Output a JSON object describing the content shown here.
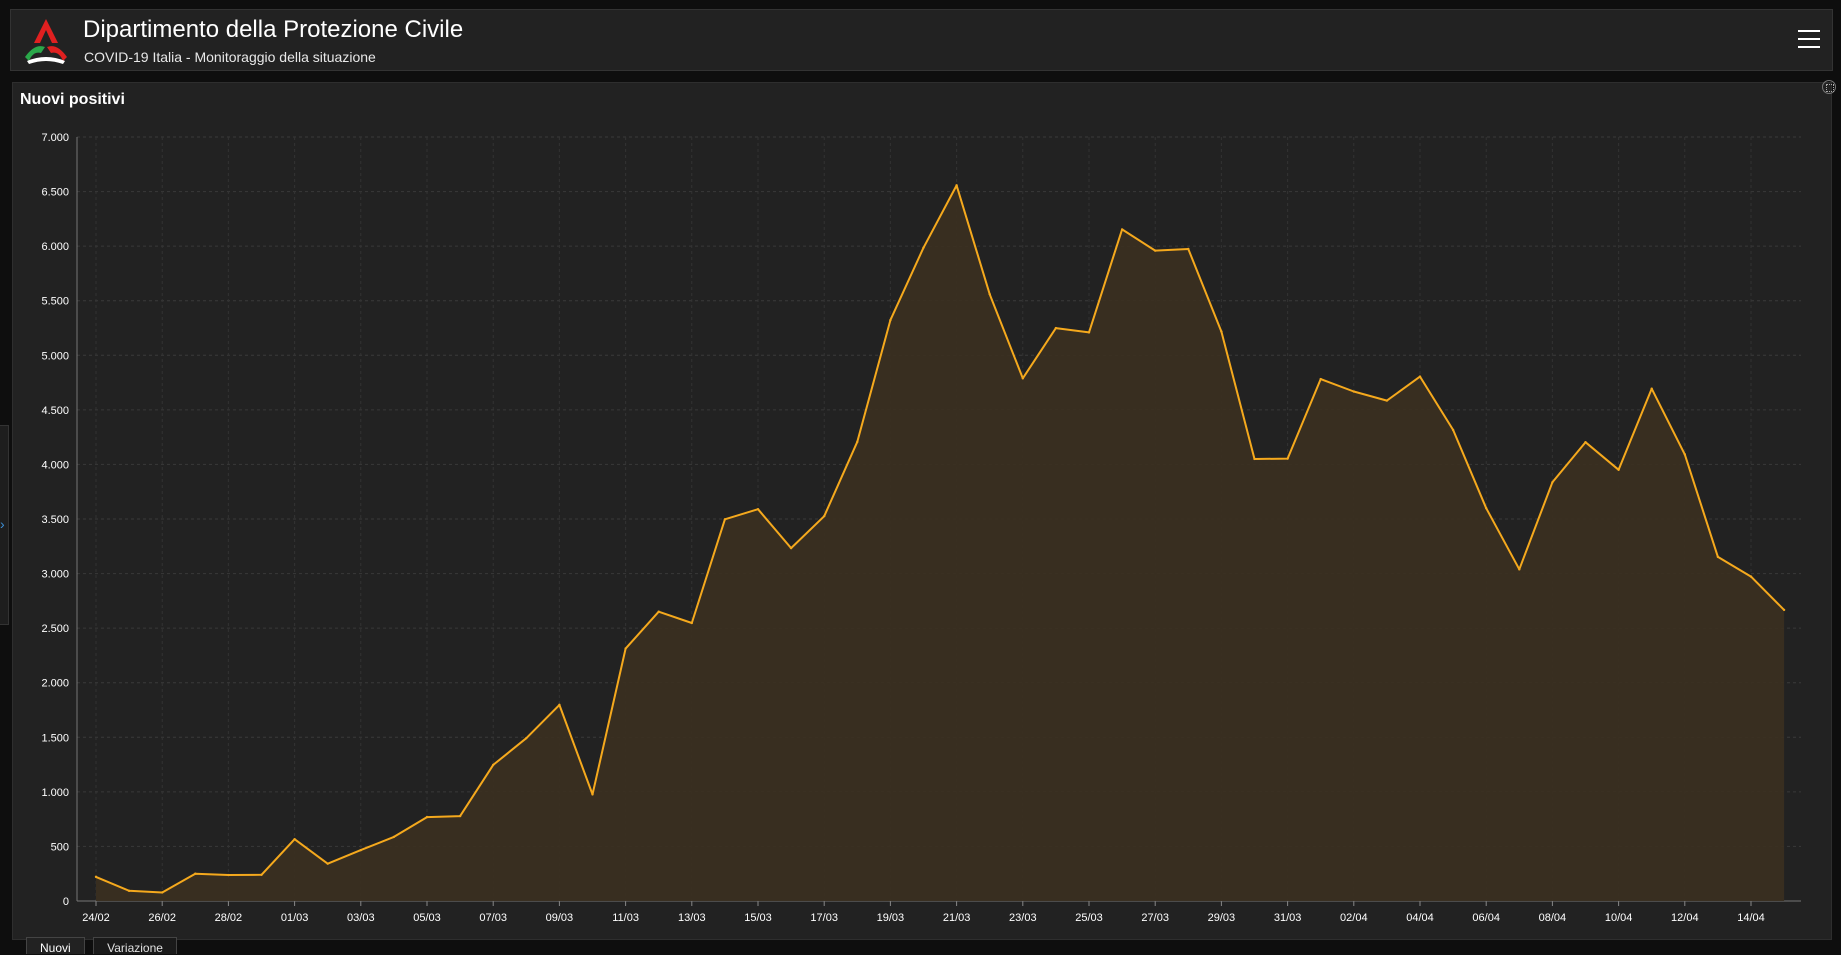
{
  "header": {
    "title": "Dipartimento della Protezione Civile",
    "subtitle": "COVID-19 Italia - Monitoraggio della situazione"
  },
  "icons": {
    "logo": "protezione-civile-logo",
    "menu": "hamburger-menu-icon",
    "expand": "expand-icon",
    "side_toggle": "chevron-right-icon"
  },
  "colors": {
    "line": "#f5a91d",
    "area": "#3a2f21",
    "background": "#222222"
  },
  "tabs": [
    {
      "label": "Nuovi",
      "active": true
    },
    {
      "label": "Variazione",
      "active": false
    }
  ],
  "chart_data": {
    "type": "area",
    "title": "Nuovi positivi",
    "xlabel": "",
    "ylabel": "",
    "ylim": [
      0,
      7000
    ],
    "yticks": [
      "0",
      "500",
      "1.000",
      "1.500",
      "2.000",
      "2.500",
      "3.000",
      "3.500",
      "4.000",
      "4.500",
      "5.000",
      "5.500",
      "6.000",
      "6.500",
      "7.000"
    ],
    "xticks": [
      "24/02",
      "26/02",
      "28/02",
      "01/03",
      "03/03",
      "05/03",
      "07/03",
      "09/03",
      "11/03",
      "13/03",
      "15/03",
      "17/03",
      "19/03",
      "21/03",
      "23/03",
      "25/03",
      "27/03",
      "29/03",
      "31/03",
      "02/04",
      "04/04",
      "06/04",
      "08/04",
      "10/04",
      "12/04",
      "14/04"
    ],
    "grid": true,
    "x": [
      "24/02",
      "25/02",
      "26/02",
      "27/02",
      "28/02",
      "29/02",
      "01/03",
      "02/03",
      "03/03",
      "04/03",
      "05/03",
      "06/03",
      "07/03",
      "08/03",
      "09/03",
      "10/03",
      "11/03",
      "12/03",
      "13/03",
      "14/03",
      "15/03",
      "16/03",
      "17/03",
      "18/03",
      "19/03",
      "20/03",
      "21/03",
      "22/03",
      "23/03",
      "24/03",
      "25/03",
      "26/03",
      "27/03",
      "28/03",
      "29/03",
      "30/03",
      "31/03",
      "01/04",
      "02/04",
      "03/04",
      "04/04",
      "05/04",
      "06/04",
      "07/04",
      "08/04",
      "09/04",
      "10/04",
      "11/04",
      "12/04",
      "13/04",
      "14/04",
      "15/04"
    ],
    "values": [
      221,
      93,
      78,
      250,
      238,
      240,
      566,
      342,
      466,
      587,
      769,
      778,
      1247,
      1492,
      1797,
      977,
      2313,
      2651,
      2547,
      3497,
      3590,
      3233,
      3526,
      4207,
      5322,
      5986,
      6557,
      5560,
      4789,
      5249,
      5210,
      6153,
      5959,
      5974,
      5217,
      4050,
      4053,
      4782,
      4668,
      4585,
      4805,
      4316,
      3599,
      3039,
      3836,
      4204,
      3951,
      4694,
      4092,
      3153,
      2972,
      2667
    ]
  }
}
